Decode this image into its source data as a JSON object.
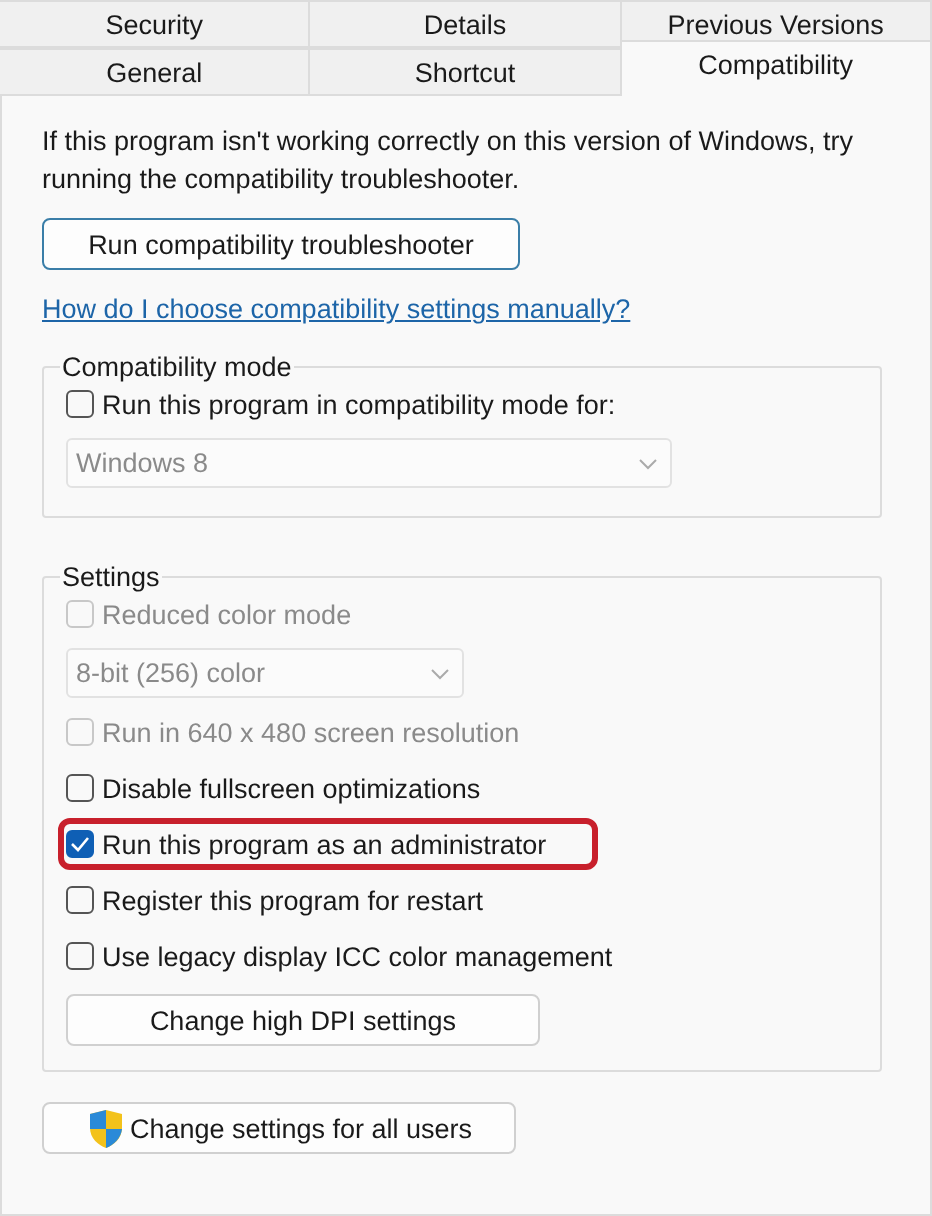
{
  "tabs": [
    [
      {
        "label": "Security",
        "selected": false
      },
      {
        "label": "Details",
        "selected": false
      },
      {
        "label": "Previous Versions",
        "selected": false
      }
    ],
    [
      {
        "label": "General",
        "selected": false
      },
      {
        "label": "Shortcut",
        "selected": false
      },
      {
        "label": "Compatibility",
        "selected": true
      }
    ]
  ],
  "intro": "If this program isn't working correctly on this version of Windows, try running the compatibility troubleshooter.",
  "troubleshooter_button": "Run compatibility troubleshooter",
  "help_link": "How do I choose compatibility settings manually?",
  "groups": [
    {
      "title": "Compatibility mode",
      "items": [
        {
          "kind": "checkbox",
          "label": "Run this program in compatibility mode for:",
          "checked": false,
          "disabled": false,
          "highlighted": false
        },
        {
          "kind": "dropdown",
          "value": "Windows 8",
          "disabled": true,
          "wide": true
        }
      ]
    },
    {
      "title": "Settings",
      "items": [
        {
          "kind": "checkbox",
          "label": "Reduced color mode",
          "checked": false,
          "disabled": true,
          "highlighted": false
        },
        {
          "kind": "dropdown",
          "value": "8-bit (256) color",
          "disabled": true,
          "wide": false
        },
        {
          "kind": "checkbox",
          "label": "Run in 640 x 480 screen resolution",
          "checked": false,
          "disabled": true,
          "highlighted": false
        },
        {
          "kind": "checkbox",
          "label": "Disable fullscreen optimizations",
          "checked": false,
          "disabled": false,
          "highlighted": false
        },
        {
          "kind": "checkbox",
          "label": "Run this program as an administrator",
          "checked": true,
          "disabled": false,
          "highlighted": true
        },
        {
          "kind": "checkbox",
          "label": "Register this program for restart",
          "checked": false,
          "disabled": false,
          "highlighted": false
        },
        {
          "kind": "checkbox",
          "label": "Use legacy display ICC color management",
          "checked": false,
          "disabled": false,
          "highlighted": false
        },
        {
          "kind": "button",
          "label": "Change high DPI settings"
        }
      ]
    }
  ],
  "all_users_button": "Change settings for all users"
}
